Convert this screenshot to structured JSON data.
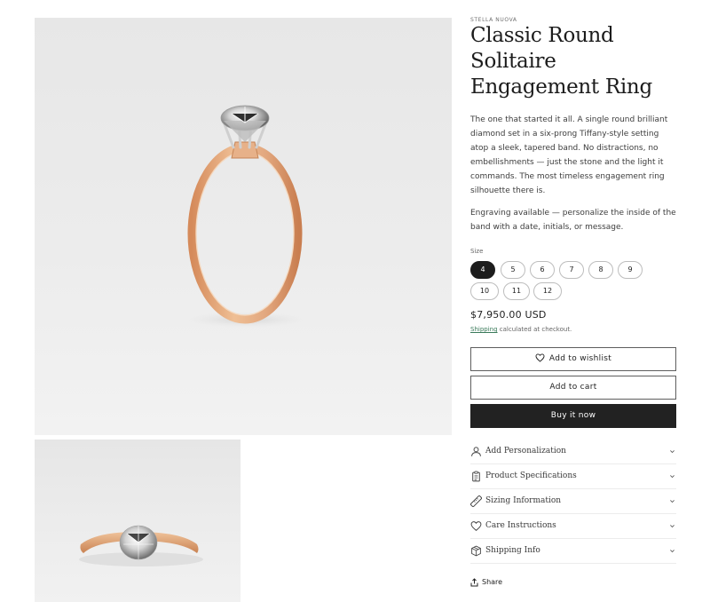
{
  "product": {
    "vendor": "STELLA NUOVA",
    "title": "Classic Round Solitaire Engagement Ring",
    "description": "The one that started it all. A single round brilliant diamond set in a six-prong Tiffany-style setting atop a sleek, tapered band. No distractions, no embellishments — just the stone and the light it commands. The most timeless engagement ring silhouette there is.",
    "engraving_note": "Engraving available — personalize the inside of the band with a date, initials, or message.",
    "price": "$7,950.00 USD",
    "shipping_link": "Shipping",
    "shipping_note": " calculated at checkout."
  },
  "size": {
    "label": "Size",
    "options": [
      "4",
      "5",
      "6",
      "7",
      "8",
      "9",
      "10",
      "11",
      "12"
    ],
    "selected": "4"
  },
  "buttons": {
    "wishlist": "Add to wishlist",
    "add_to_cart": "Add to cart",
    "buy_now": "Buy it now"
  },
  "accordion": [
    {
      "label": "Add Personalization",
      "icon": "person-icon"
    },
    {
      "label": "Product Specifications",
      "icon": "clipboard-icon"
    },
    {
      "label": "Sizing Information",
      "icon": "ruler-icon"
    },
    {
      "label": "Care Instructions",
      "icon": "heart-icon"
    },
    {
      "label": "Shipping Info",
      "icon": "box-icon"
    }
  ],
  "share": {
    "label": "Share",
    "icon": "share-icon"
  },
  "colors": {
    "accent": "#222222",
    "link": "#3a7a5a",
    "gold": "#e2a77e"
  }
}
